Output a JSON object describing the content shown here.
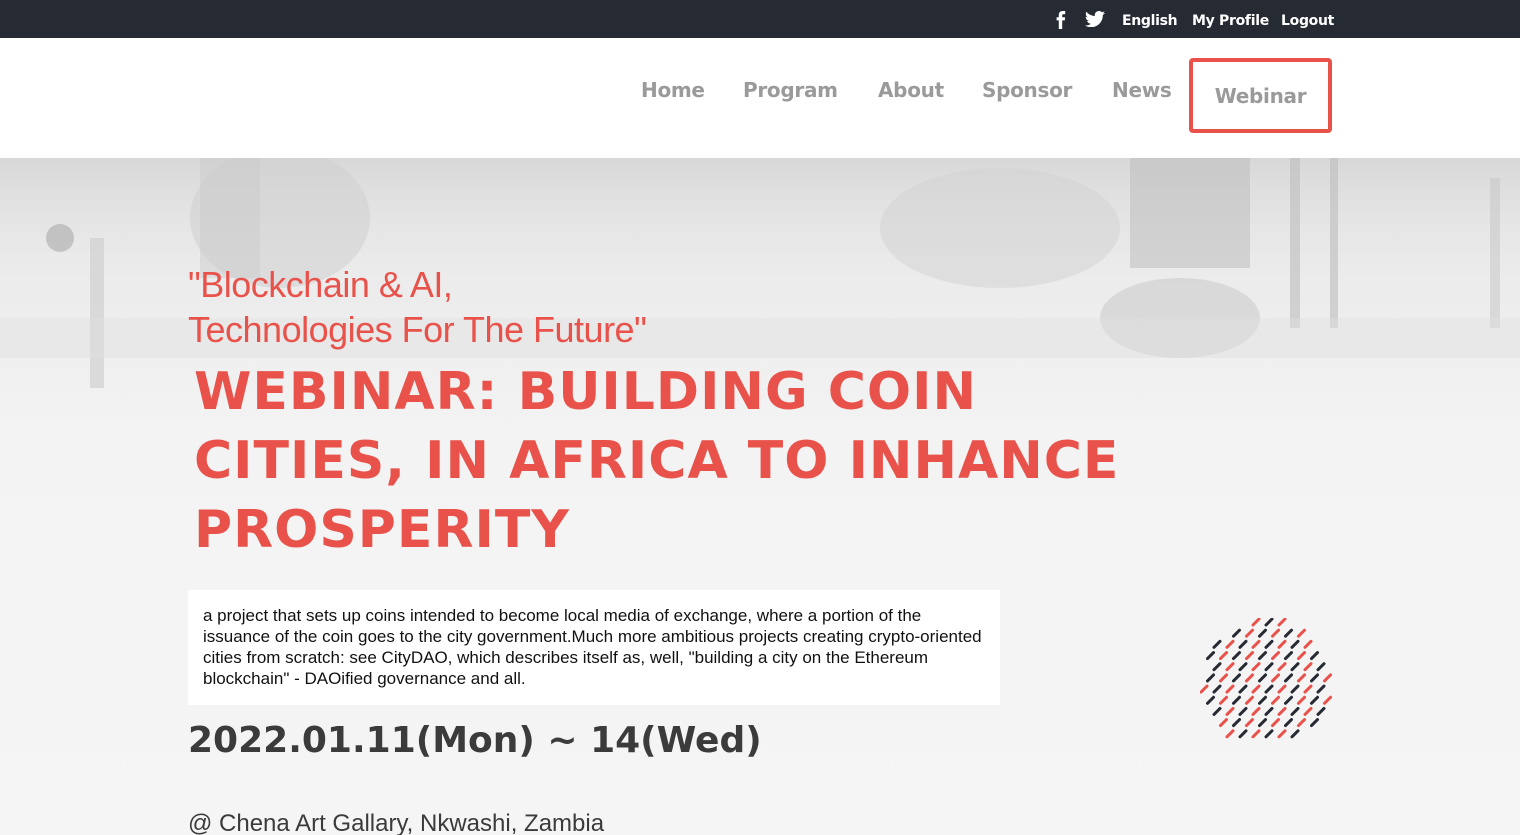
{
  "topbar": {
    "icons": [
      "facebook-icon",
      "twitter-icon"
    ],
    "language": "English",
    "profile": "My Profile",
    "logout": "Logout"
  },
  "nav": {
    "items": [
      {
        "label": "Home"
      },
      {
        "label": "Program"
      },
      {
        "label": "About"
      },
      {
        "label": "Sponsor"
      },
      {
        "label": "News"
      },
      {
        "label": "Webinar",
        "active": true
      }
    ]
  },
  "hero": {
    "subtitle": "\"Blockchain & AI,\nTechnologies For The Future\"",
    "title": "Webinar: Building Coin Cities, in Africa to inhance prosperity",
    "description": "a project that sets up coins intended to become local media of exchange, where a portion of the issuance of the coin goes to the city government.Much more ambitious projects creating crypto-oriented cities from scratch: see CityDAO, which describes itself as, well, \"building a city on the Ethereum blockchain\" - DAOified governance and all.",
    "date": "2022.01.11(Mon) ~ 14(Wed)",
    "venue": "@ Chena Art Gallary, Nkwashi, Zambia"
  },
  "colors": {
    "accent": "#e8524a",
    "topbar_bg": "#262a33",
    "nav_text": "#9a9a9a",
    "dark_text": "#3b3b3b"
  }
}
